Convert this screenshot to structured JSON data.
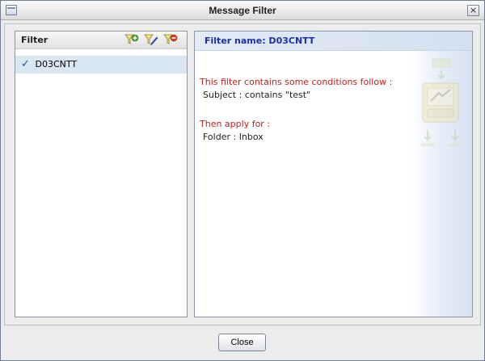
{
  "window": {
    "title": "Message Filter",
    "close_glyph": "×"
  },
  "filter_panel": {
    "header_label": "Filter",
    "toolbar": [
      {
        "icon": "add-filter-icon"
      },
      {
        "icon": "edit-filter-icon"
      },
      {
        "icon": "delete-filter-icon"
      }
    ],
    "items": [
      {
        "check": "✓",
        "name": "D03CNTT",
        "selected": true
      }
    ]
  },
  "detail_panel": {
    "header_prefix": "Filter name: D03CNTT",
    "conditions_title": "This filter contains some conditions follow :",
    "condition_line": "Subject : contains \"test\"",
    "actions_title": "Then apply for :",
    "action_line": "Folder : Inbox",
    "watermark_icon": "filter-watermark-icon"
  },
  "footer": {
    "close_label": "Close"
  },
  "colors": {
    "selection": "#dbe6f3",
    "header_text": "#1f2fa6",
    "section_title": "#c02020"
  }
}
